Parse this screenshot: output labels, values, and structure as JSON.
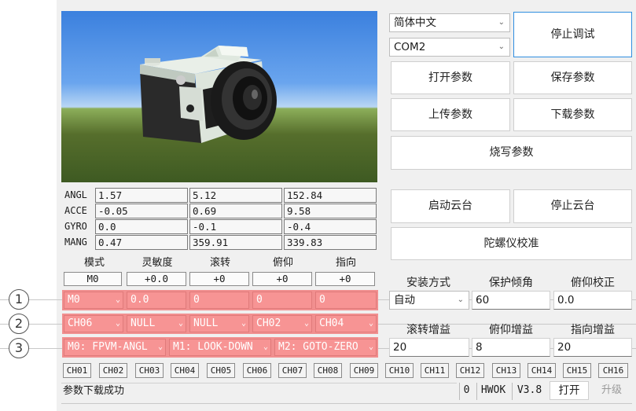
{
  "viewport": {
    "label": "3D attitude preview"
  },
  "sensors": [
    {
      "label": "ANGL",
      "values": [
        "1.57",
        "5.12",
        "152.84"
      ]
    },
    {
      "label": "ACCE",
      "values": [
        "-0.05",
        "0.69",
        "9.58"
      ]
    },
    {
      "label": "GYRO",
      "values": [
        "0.0",
        "-0.1",
        "-0.4"
      ]
    },
    {
      "label": "MANG",
      "values": [
        "0.47",
        "359.91",
        "339.83"
      ]
    }
  ],
  "axis_headers": [
    "模式",
    "灵敏度",
    "滚转",
    "俯仰",
    "指向"
  ],
  "axis_values": [
    "M0",
    "+0.0",
    "+0",
    "+0",
    "+0"
  ],
  "row1": [
    "M0",
    "0.0",
    "0",
    "0",
    "0"
  ],
  "row2": [
    "CH06",
    "NULL",
    "NULL",
    "CH02",
    "CH04"
  ],
  "row3": [
    "M0: FPVM-ANGL",
    "M1: LOOK-DOWN",
    "M2: GOTO-ZERO"
  ],
  "markers": [
    "1",
    "2",
    "3"
  ],
  "right": {
    "language": "简体中文",
    "port": "COM2",
    "stop_debug": "停止调试",
    "open_params": "打开参数",
    "save_params": "保存参数",
    "upload_params": "上传参数",
    "download_params": "下载参数",
    "flash_params": "烧写参数",
    "start_gimbal": "启动云台",
    "stop_gimbal": "停止云台",
    "gyro_calib": "陀螺仪校准",
    "mount_label": "安装方式",
    "protect_label": "保护倾角",
    "pitch_correct_label": "俯仰校正",
    "mount_value": "自动",
    "protect_value": "60",
    "pitch_correct_value": "0.0",
    "roll_gain_label": "滚转增益",
    "pitch_gain_label": "俯仰增益",
    "yaw_gain_label": "指向增益",
    "roll_gain_value": "20",
    "pitch_gain_value": "8",
    "yaw_gain_value": "20"
  },
  "channels": [
    "CH01",
    "CH02",
    "CH03",
    "CH04",
    "CH05",
    "CH06",
    "CH07",
    "CH08",
    "CH09",
    "CH10",
    "CH11",
    "CH12",
    "CH13",
    "CH14",
    "CH15",
    "CH16"
  ],
  "status": {
    "message": "参数下载成功",
    "count": "0",
    "hw": "HWOK",
    "version": "V3.8",
    "open": "打开",
    "upgrade": "升级"
  }
}
